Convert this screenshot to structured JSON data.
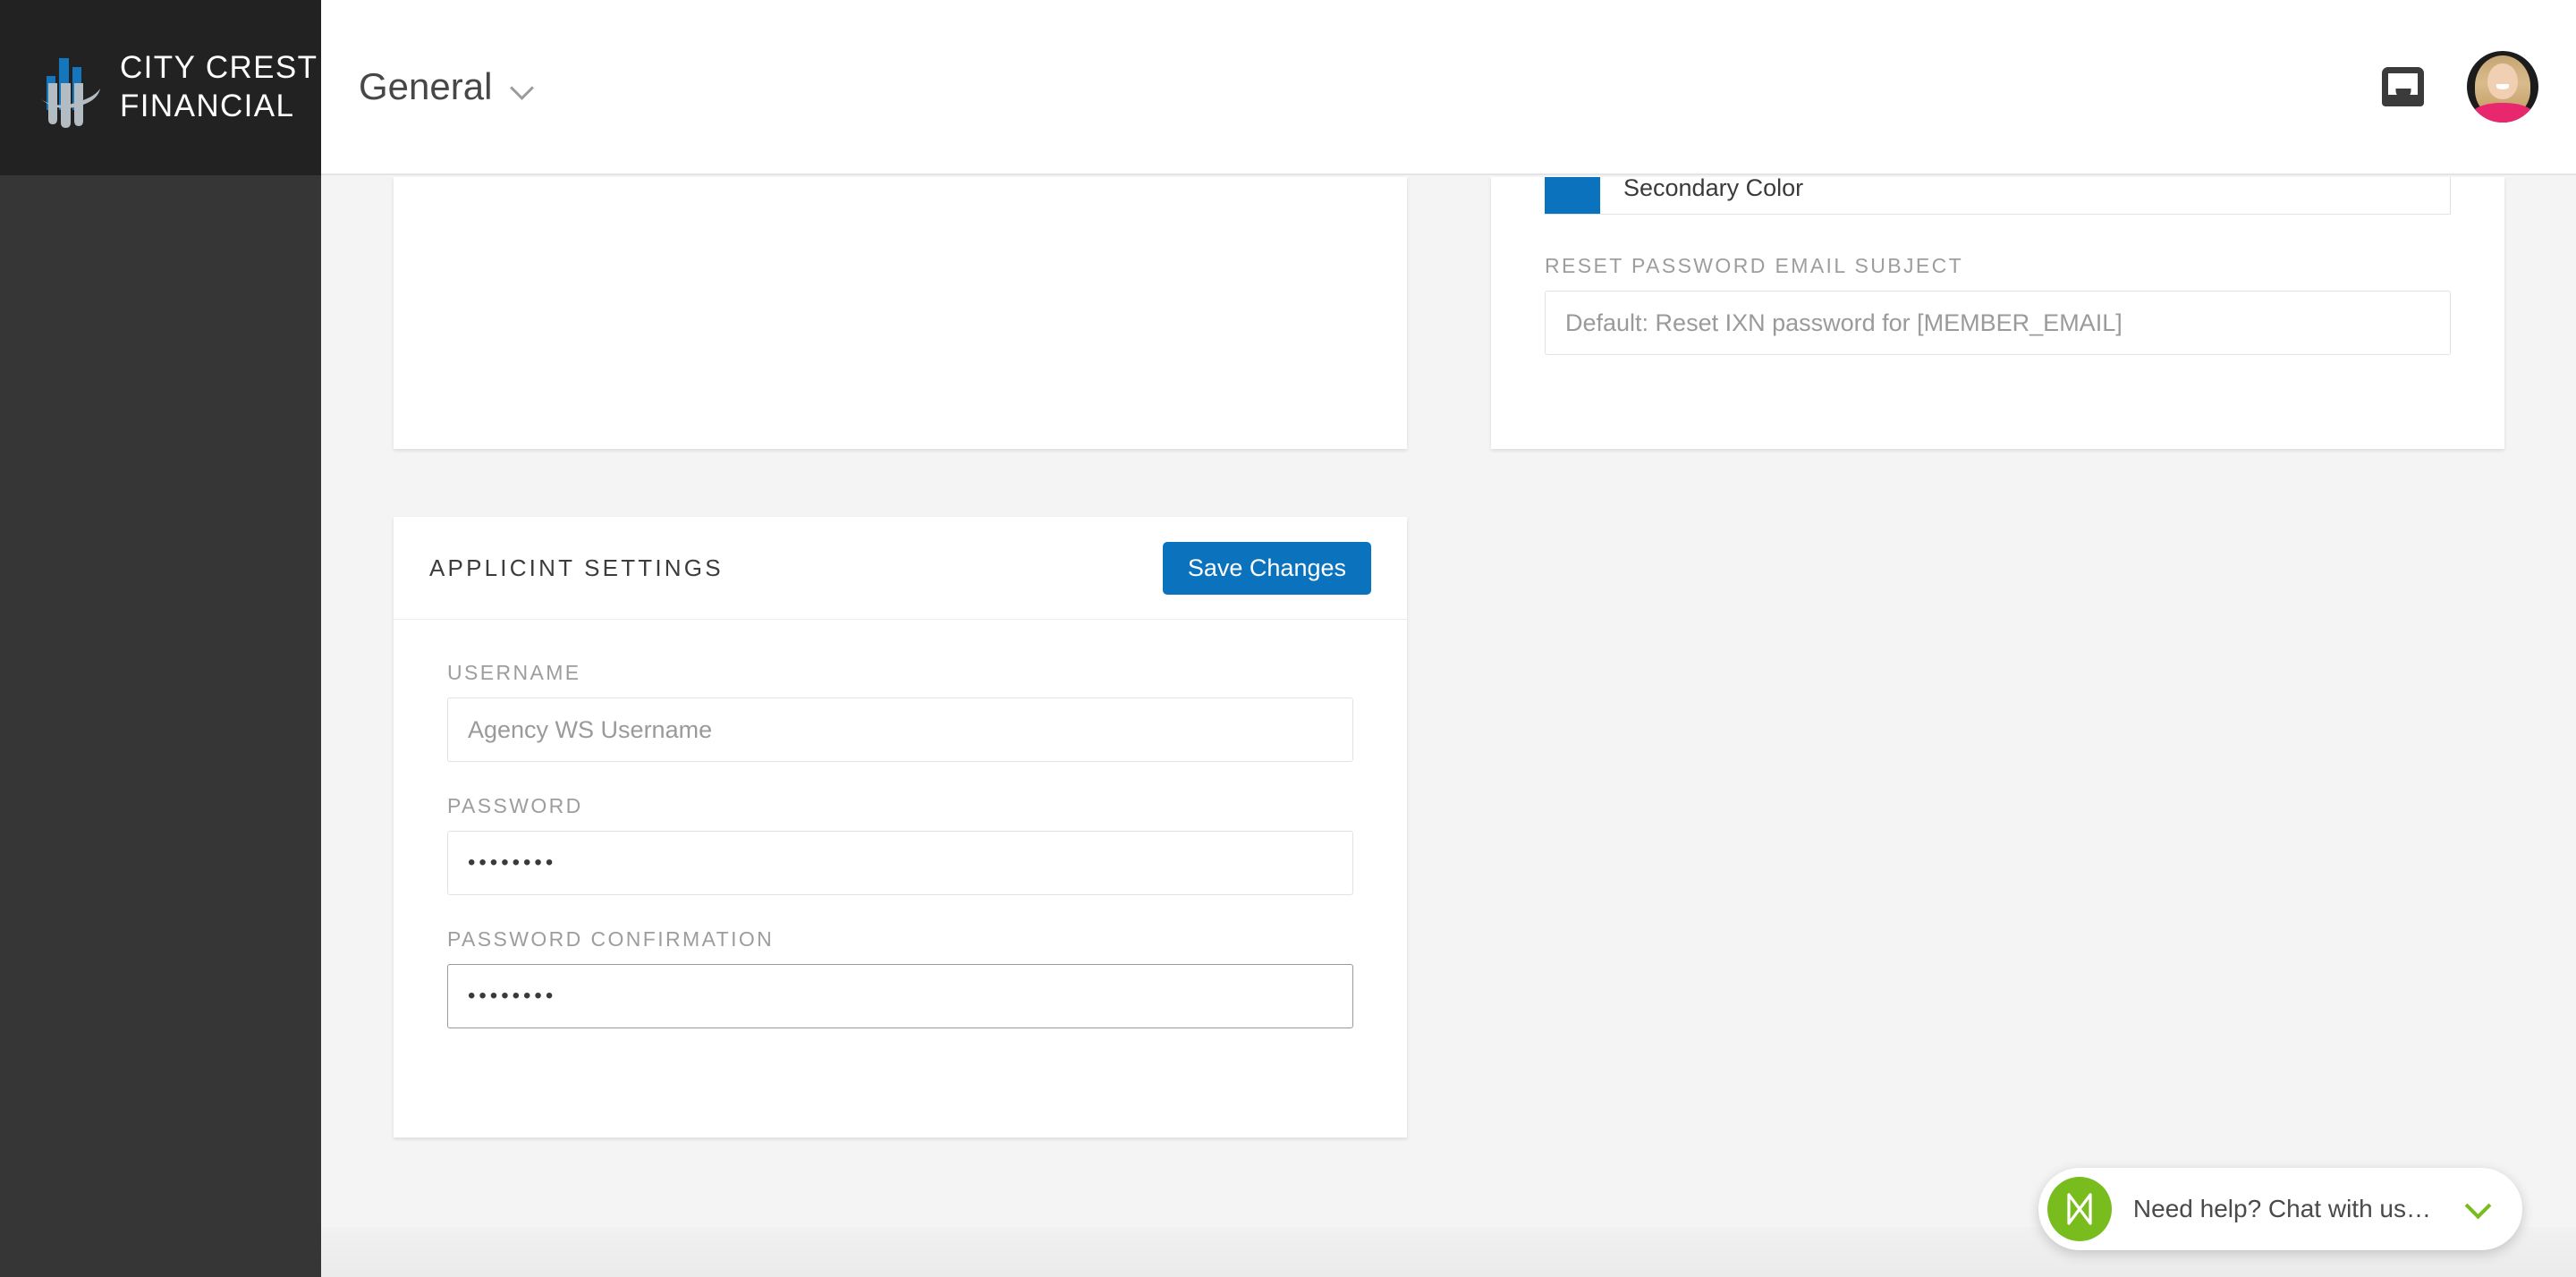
{
  "brand": {
    "name_line1": "CITY CREST",
    "name_line2": "FINANCIAL",
    "logo_icon": "city-crest-bars-logo",
    "sidebar_bg": "#363636",
    "logo_bg": "#222222",
    "logo_blue": "#1476bd",
    "logo_grey": "#b3bcc2"
  },
  "header": {
    "title": "General",
    "dropdown_icon": "chevron-down-icon",
    "inbox_icon": "inbox-icon",
    "avatar_icon": "user-avatar"
  },
  "accent": {
    "primary_blue": "#0b72be",
    "chat_green": "#79bc1e"
  },
  "cards": {
    "branding": {
      "color_row": {
        "swatch_color": "#0b72be",
        "label": "Secondary Color"
      },
      "reset_subject": {
        "label": "RESET PASSWORD EMAIL SUBJECT",
        "placeholder": "Default: Reset IXN password for [MEMBER_EMAIL]",
        "value": ""
      }
    },
    "applicint": {
      "title": "APPLICINT SETTINGS",
      "save_label": "Save Changes",
      "fields": [
        {
          "label": "USERNAME",
          "placeholder": "Agency WS Username",
          "value": "",
          "type": "text",
          "focused": false
        },
        {
          "label": "PASSWORD",
          "placeholder": "",
          "value": "••••••••",
          "type": "password",
          "focused": false
        },
        {
          "label": "PASSWORD CONFIRMATION",
          "placeholder": "",
          "value": "••••••••",
          "type": "password",
          "focused": true
        }
      ]
    }
  },
  "chat": {
    "message": "Need help? Chat with us…",
    "logo_icon": "chat-brand-icon",
    "collapse_icon": "chevron-down-icon"
  }
}
